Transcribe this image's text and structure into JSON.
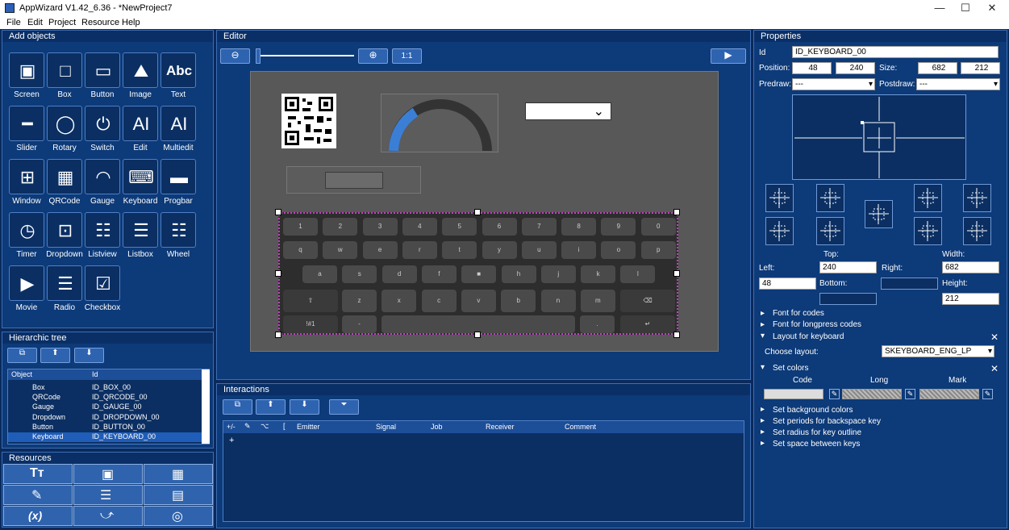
{
  "window": {
    "title": "AppWizard V1.42_6.36 - *NewProject7",
    "minimize": "—",
    "maximize": "☐",
    "close": "✕"
  },
  "menu": [
    "File",
    "Edit",
    "Project",
    "Resource",
    "Help"
  ],
  "add_objects": {
    "title": "Add objects",
    "items": [
      "Screen",
      "Box",
      "Button",
      "Image",
      "Text",
      "Slider",
      "Rotary",
      "Switch",
      "Edit",
      "Multiedit",
      "Window",
      "QRCode",
      "Gauge",
      "Keyboard",
      "Progbar",
      "Timer",
      "Dropdown",
      "Listview",
      "Listbox",
      "Wheel",
      "Movie",
      "Radio",
      "Checkbox"
    ]
  },
  "hier": {
    "title": "Hierarchic tree",
    "headers": [
      "Object",
      "Id"
    ],
    "rows": [
      {
        "obj": "Box",
        "id": "ID_BOX_00"
      },
      {
        "obj": "QRCode",
        "id": "ID_QRCODE_00"
      },
      {
        "obj": "Gauge",
        "id": "ID_GAUGE_00"
      },
      {
        "obj": "Dropdown",
        "id": "ID_DROPDOWN_00"
      },
      {
        "obj": "Button",
        "id": "ID_BUTTON_00"
      },
      {
        "obj": "Keyboard",
        "id": "ID_KEYBOARD_00"
      }
    ]
  },
  "resources": {
    "title": "Resources"
  },
  "editor": {
    "title": "Editor",
    "zoom_reset": "1:1"
  },
  "keyboard": {
    "row1": [
      "1",
      "2",
      "3",
      "4",
      "5",
      "6",
      "7",
      "8",
      "9",
      "0"
    ],
    "row2": [
      "q",
      "w",
      "e",
      "r",
      "t",
      "y",
      "u",
      "i",
      "o",
      "p"
    ],
    "row3": [
      "a",
      "s",
      "d",
      "f",
      "■",
      "h",
      "j",
      "k",
      "l"
    ],
    "row4": [
      "z",
      "x",
      "c",
      "v",
      "b",
      "n",
      "m"
    ],
    "mode": "!#1",
    "dash": "-",
    "dot": "."
  },
  "interactions": {
    "title": "Interactions",
    "headers": [
      "+/-",
      "✎",
      "⌥",
      "[",
      "Emitter",
      "Signal",
      "Job",
      "Receiver",
      "Comment"
    ],
    "add": "+"
  },
  "properties": {
    "title": "Properties",
    "id_label": "Id",
    "id_value": "ID_KEYBOARD_00",
    "position_label": "Position:",
    "pos_x": "48",
    "pos_y": "240",
    "size_label": "Size:",
    "size_w": "682",
    "size_h": "212",
    "predraw_label": "Predraw:",
    "predraw_value": "---",
    "postdraw_label": "Postdraw:",
    "postdraw_value": "---",
    "top_label": "Top:",
    "width_label": "Width:",
    "left_label": "Left:",
    "left_value": "240",
    "right_label": "Right:",
    "right_value": "682",
    "x_value": "48",
    "bottom_label": "Bottom:",
    "height_label": "Height:",
    "height_value": "212",
    "sections": [
      "Font for codes",
      "Font for longpress codes",
      "Layout for keyboard"
    ],
    "choose_layout_label": "Choose layout:",
    "layout_value": "SKEYBOARD_ENG_LP",
    "set_colors": "Set colors",
    "color_cols": [
      "Code",
      "Long",
      "Mark"
    ],
    "more_sections": [
      "Set background colors",
      "Set periods for backspace key",
      "Set radius for key outline",
      "Set space between keys"
    ]
  }
}
